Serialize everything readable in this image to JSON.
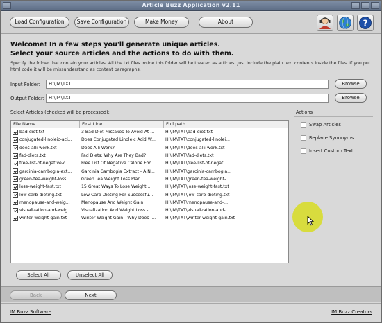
{
  "window": {
    "title": "Article Buzz Application v2.11"
  },
  "toolbar": {
    "buttons": [
      "Load Configuration",
      "Save Configuration",
      "Make Money",
      "About"
    ],
    "icons": [
      "user-support-icon",
      "globe-icon",
      "help-icon"
    ]
  },
  "intro": {
    "line1": "Welcome! In a few steps you'll generate unique articles.",
    "line2": "Select your source articles and the actions to do with them.",
    "description": "Specify the folder that contain your articles. All the txt files inside this folder will be treated as articles. Just include the plain text contents inside the files. If you put html code it will be missunderstand as content paragraphs."
  },
  "folders": {
    "input_label": "Input Folder:",
    "input_value": "H:\\IM\\TXT",
    "output_label": "Output Folder:",
    "output_value": "H:\\IM\\TXT",
    "browse_label": "Browse"
  },
  "articles": {
    "label": "Select Articles (checked will be processed):",
    "columns": [
      "File Name",
      "First Line",
      "Full path",
      ""
    ],
    "rows": [
      {
        "file": "bad-diet.txt",
        "first": "3 Bad Diet Mistakes To Avoid At ...",
        "path": "H:\\IM\\TXT\\bad-diet.txt",
        "checked": true
      },
      {
        "file": "conjugated-linoleic-aci...",
        "first": "Does Conjugated Linoleic Acid W...",
        "path": "H:\\IM\\TXT\\conjugated-linolei...",
        "checked": true
      },
      {
        "file": "does-alli-work.txt",
        "first": "Does Alli Work?",
        "path": "H:\\IM\\TXT\\does-alli-work.txt",
        "checked": true
      },
      {
        "file": "fad-diets.txt",
        "first": "Fad Diets: Why Are They Bad?",
        "path": "H:\\IM\\TXT\\fad-diets.txt",
        "checked": true
      },
      {
        "file": "free-list-of-negative-c...",
        "first": "Free List Of Negative Calorie Foo...",
        "path": "H:\\IM\\TXT\\free-list-of-negati...",
        "checked": true
      },
      {
        "file": "garcinia-cambogia-ext...",
        "first": "Garcinia Cambogia Extract - A N...",
        "path": "H:\\IM\\TXT\\garcinia-cambogia...",
        "checked": true
      },
      {
        "file": "green-tea-weight-loss...",
        "first": "Green Tea Weight Loss Plan",
        "path": "H:\\IM\\TXT\\green-tea-weight-...",
        "checked": true
      },
      {
        "file": "lose-weight-fast.txt",
        "first": "15 Great Ways To Lose Weight ...",
        "path": "H:\\IM\\TXT\\lose-weight-fast.txt",
        "checked": true
      },
      {
        "file": "low-carb-dieting.txt",
        "first": "Low Carb Dieting For Successfu...",
        "path": "H:\\IM\\TXT\\low-carb-dieting.txt",
        "checked": true
      },
      {
        "file": "menopause-and-weig...",
        "first": "Menopause And Weight Gain",
        "path": "H:\\IM\\TXT\\menopause-and-...",
        "checked": true
      },
      {
        "file": "visualization-and-weig...",
        "first": "Visualization And Weight Loss - ...",
        "path": "H:\\IM\\TXT\\visualization-and-...",
        "checked": true
      },
      {
        "file": "winter-weight-gain.txt",
        "first": "Winter Weight Gain - Why Does I...",
        "path": "H:\\IM\\TXT\\winter-weight-gain.txt",
        "checked": true
      }
    ],
    "select_all": "Select All",
    "unselect_all": "Unselect All"
  },
  "actions": {
    "label": "Actions",
    "items": [
      {
        "label": "Swap Articles",
        "checked": false
      },
      {
        "label": "Replace Synonyms",
        "checked": false
      },
      {
        "label": "Insert Custom Text",
        "checked": false
      }
    ]
  },
  "nav": {
    "back": "Back",
    "next": "Next"
  },
  "footer": {
    "left": "IM Buzz Software",
    "right": "IM Buzz Creators"
  },
  "colors": {
    "cursor_highlight": "#d7dc28",
    "title_bar": "#6e7e96"
  }
}
